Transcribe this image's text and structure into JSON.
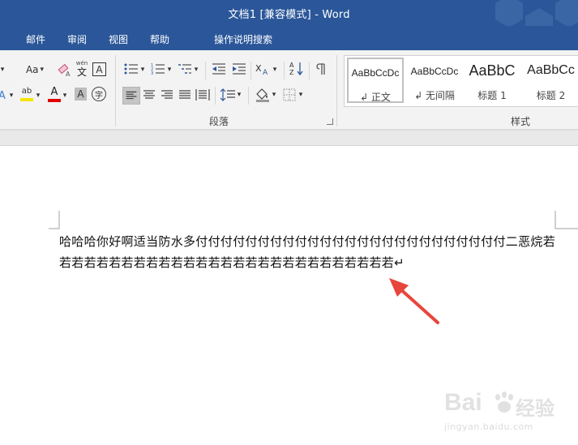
{
  "title_bar": {
    "title": "文档1 [兼容模式]  -  Word"
  },
  "menu": {
    "items": [
      "邮件",
      "审阅",
      "视图",
      "帮助"
    ],
    "tell_me_label": "操作说明搜索"
  },
  "ribbon": {
    "font_group": {
      "font_size_label": "Aa",
      "phonetic_label": "wén",
      "phonetic_char": "文",
      "char_border": "A",
      "highlight_label": "ab",
      "font_color_label": "A",
      "char_shading": "A",
      "enclose_char": "字"
    },
    "paragraph_group": {
      "label": "段落"
    },
    "styles_group": {
      "label": "样式",
      "items": [
        {
          "preview": "AaBbCcDc",
          "name": "↲ 正文"
        },
        {
          "preview": "AaBbCcDc",
          "name": "↲ 无间隔"
        },
        {
          "preview": "AaBbC",
          "name": "标题 1"
        },
        {
          "preview": "AaBbCc",
          "name": "标题 2"
        }
      ]
    }
  },
  "document": {
    "lines": [
      "哈哈哈你好啊适当防水多付付付付付付付付付付付付付付付付付付付付付付付付付二恶烷若",
      "若若若若若若若若若若若若若若若若若若若若若若若若若若若↵"
    ]
  },
  "watermark": {
    "brand": "Bai",
    "brand_tail": "经验",
    "url": "jingyan.baidu.com"
  },
  "colors": {
    "title_bar": "#2b579a",
    "ribbon": "#f3f3f3",
    "annotation_arrow": "#e8453c",
    "font_color_underline": "#e00000",
    "highlight_underline": "#f3e600"
  }
}
